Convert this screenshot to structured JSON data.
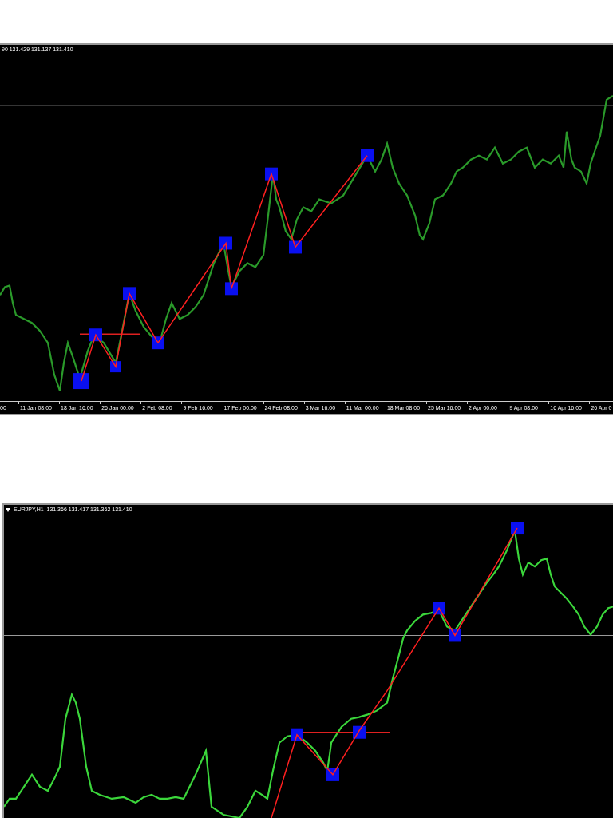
{
  "charts": [
    {
      "header": "90 131.429 131.137 131.410",
      "menu_marker": false,
      "time_labels": [
        "00",
        "11 Jan 08:00",
        "18 Jan 16:00",
        "26 Jan 00:00",
        "2 Feb 08:00",
        "9 Feb 16:00",
        "17 Feb 00:00",
        "24 Feb 08:00",
        "3 Mar 16:00",
        "11 Mar 00:00",
        "18 Mar 08:00",
        "25 Mar 16:00",
        "2 Apr 00:00",
        "9 Apr 08:00",
        "16 Apr 16:00",
        "26 Apr 0"
      ]
    },
    {
      "header": "EURJPY,H1  131.366 131.417 131.362 131.410",
      "menu_marker": true
    }
  ]
}
